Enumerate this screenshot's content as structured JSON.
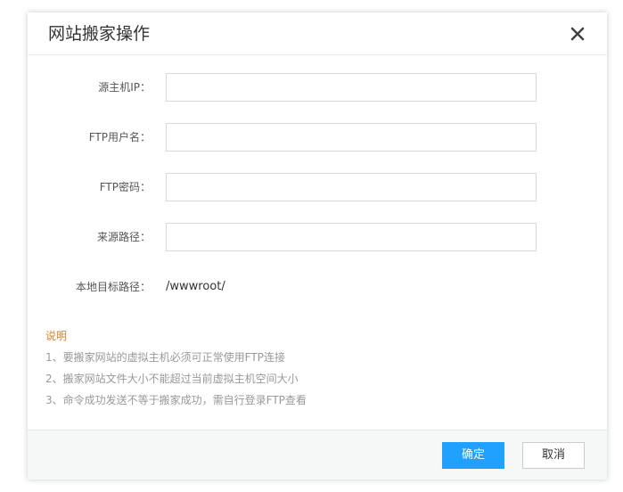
{
  "dialog": {
    "title": "网站搬家操作",
    "close_icon": "close-icon"
  },
  "form": {
    "host_ip": {
      "label": "源主机IP：",
      "value": "",
      "placeholder": ""
    },
    "ftp_user": {
      "label": "FTP用户名：",
      "value": "",
      "placeholder": ""
    },
    "ftp_password": {
      "label": "FTP密码：",
      "value": "",
      "placeholder": ""
    },
    "source_path": {
      "label": "来源路径：",
      "value": "",
      "placeholder": ""
    },
    "local_path": {
      "label": "本地目标路径：",
      "value": "/wwwroot/"
    }
  },
  "notes": {
    "title": "说明",
    "items": [
      "1、要搬家网站的虚拟主机必须可正常使用FTP连接",
      "2、搬家网站文件大小不能超过当前虚拟主机空间大小",
      "3、命令成功发送不等于搬家成功，需自行登录FTP查看"
    ]
  },
  "footer": {
    "confirm_label": "确定",
    "cancel_label": "取消"
  },
  "colors": {
    "primary": "#20a0ff",
    "note_title": "#e0822e",
    "note_text": "#999999"
  }
}
